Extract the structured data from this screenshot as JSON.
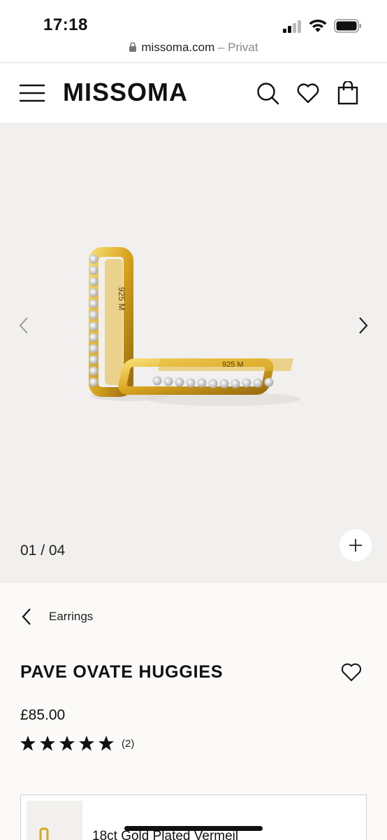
{
  "status_bar": {
    "time": "17:18",
    "url_domain": "missoma.com",
    "url_suffix": " – Privat",
    "icons": [
      "signal-icon",
      "wifi-icon",
      "battery-icon",
      "lock-icon"
    ]
  },
  "nav": {
    "logo": "MISSOMA",
    "icons": [
      "menu-icon",
      "search-icon",
      "heart-icon",
      "bag-icon"
    ]
  },
  "gallery": {
    "counter": "01 / 04",
    "engraving": "925 M",
    "icons": [
      "chevron-left-icon",
      "chevron-right-icon",
      "plus-icon"
    ]
  },
  "product": {
    "breadcrumb": "Earrings",
    "title": "PAVE OVATE HUGGIES",
    "price": "£85.00",
    "rating": {
      "stars": 5,
      "max": 5,
      "count_label": "(2)"
    },
    "variant_label": "18ct Gold Plated Vermeil"
  },
  "colors": {
    "gold": "#d9a520",
    "background": "#f1f0ee",
    "text": "#111111"
  }
}
